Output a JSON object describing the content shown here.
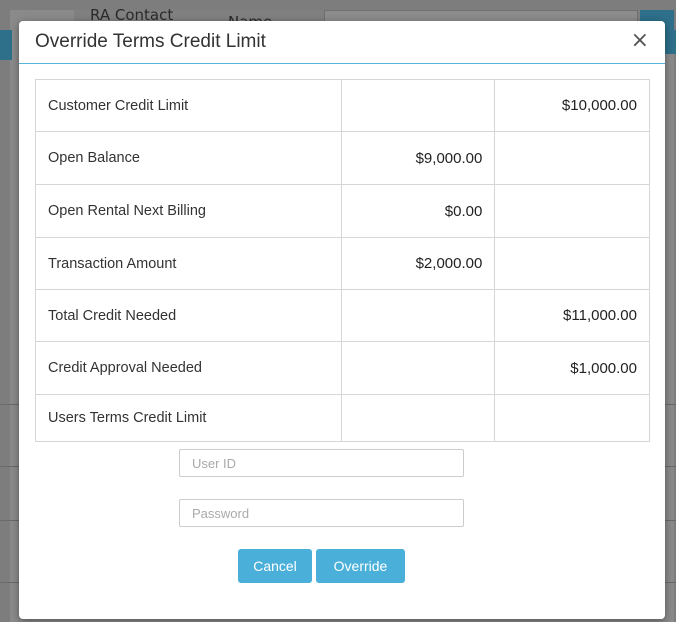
{
  "background": {
    "text_left": "RA Contact",
    "text_right": "Name"
  },
  "dialog": {
    "title": "Override Terms Credit Limit",
    "close_glyph": "×",
    "rows": [
      {
        "label": "Customer Credit Limit",
        "mid": "",
        "right": "$10,000.00"
      },
      {
        "label": "Open Balance",
        "mid": "$9,000.00",
        "right": ""
      },
      {
        "label": "Open Rental Next Billing",
        "mid": "$0.00",
        "right": ""
      },
      {
        "label": "Transaction Amount",
        "mid": "$2,000.00",
        "right": ""
      },
      {
        "label": "Total Credit Needed",
        "mid": "",
        "right": "$11,000.00"
      },
      {
        "label": "Credit Approval Needed",
        "mid": "",
        "right": "$1,000.00"
      },
      {
        "label": "Users Terms Credit Limit",
        "mid": "",
        "right": ""
      }
    ],
    "user_id": {
      "value": "",
      "placeholder": "User ID"
    },
    "password": {
      "value": "",
      "placeholder": "Password"
    },
    "cancel_label": "Cancel",
    "override_label": "Override"
  },
  "colors": {
    "button": "#4ab0d9",
    "header_rule": "#56b4d8",
    "overlay": "#7d7d7d"
  }
}
